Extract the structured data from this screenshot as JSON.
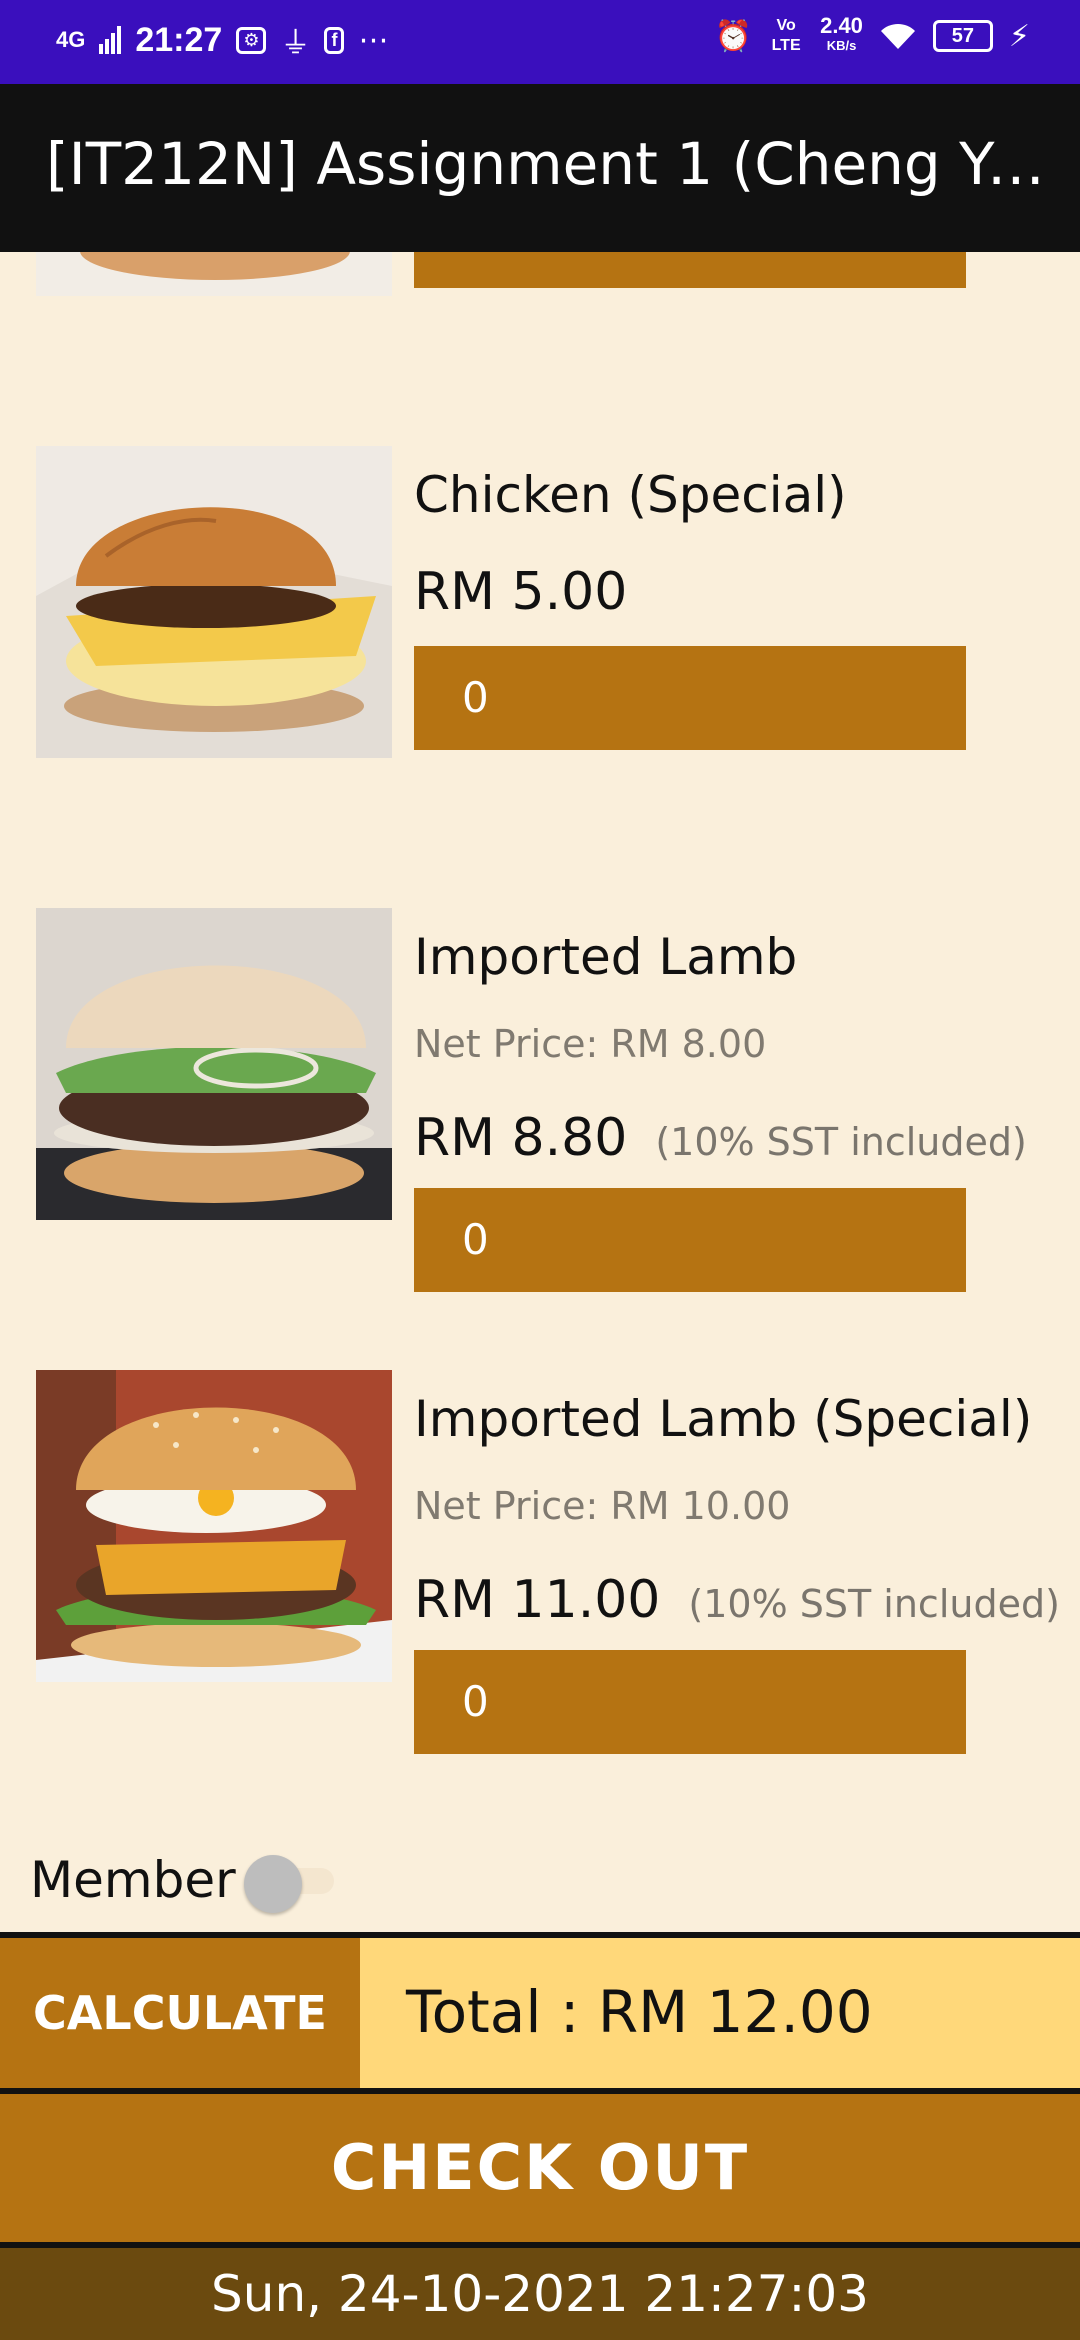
{
  "status_bar": {
    "network": "4G",
    "time": "21:27",
    "speed_value": "2.40",
    "speed_unit": "KB/s",
    "volte": "Vo LTE",
    "battery": "57",
    "icons": [
      "signal-icon",
      "usb-debug-icon",
      "usb-icon",
      "facebook-icon",
      "more-dots-icon",
      "alarm-icon",
      "wifi-icon",
      "battery-icon",
      "charging-icon"
    ]
  },
  "app_bar": {
    "title": "[IT212N] Assignment 1 (Cheng Yo..."
  },
  "items": [
    {
      "title": "Chicken (Special)",
      "price": "RM 5.00",
      "qty": "0",
      "image": "chicken-special-burger-image"
    },
    {
      "title": "Imported Lamb",
      "net_price": "Net Price: RM 8.00",
      "price": "RM 8.80",
      "sst": "(10% SST included)",
      "qty": "0",
      "image": "imported-lamb-burger-image"
    },
    {
      "title": "Imported Lamb (Special)",
      "net_price": "Net Price: RM 10.00",
      "price": "RM 11.00",
      "sst": "(10% SST included)",
      "qty": "0",
      "image": "imported-lamb-special-burger-image"
    }
  ],
  "member": {
    "label": "Member",
    "checked": false
  },
  "calculate": {
    "label": "CALCULATE"
  },
  "total": {
    "text": "Total : RM 12.00"
  },
  "checkout": {
    "label": "CHECK OUT"
  },
  "datetime": "Sun, 24-10-2021 21:27:03",
  "colors": {
    "status_bar": "#3a0fbd",
    "app_bar": "#111111",
    "background": "#faefdb",
    "accent": "#b57312",
    "total_bg": "#ffd87a",
    "datetime_bg": "#6b4a0f"
  }
}
